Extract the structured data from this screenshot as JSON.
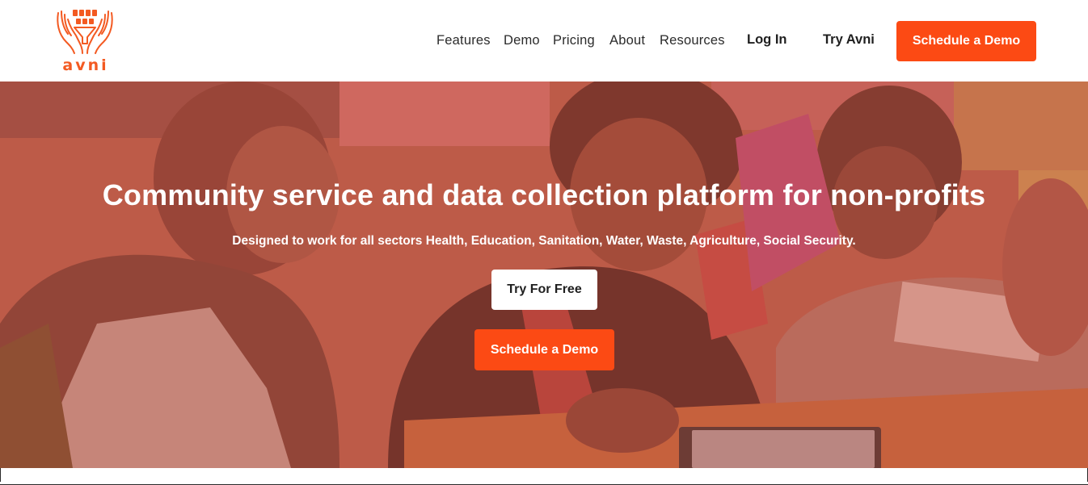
{
  "brand": {
    "name": "avni",
    "accent_color": "#fc4a14",
    "logo_icon": "hands-holding-data-icon"
  },
  "nav": {
    "links": [
      "Features",
      "Demo",
      "Pricing",
      "About",
      "Resources"
    ],
    "login": "Log In",
    "try": "Try Avni",
    "schedule": "Schedule a Demo"
  },
  "hero": {
    "title": "Community service and data collection platform for non-profits",
    "subtitle": "Designed to work for all sectors Health, Education, Sanitation, Water, Waste, Agriculture, Social Security.",
    "try_free": "Try For Free",
    "schedule": "Schedule a Demo",
    "background_image": "women-working-with-tablet-photo"
  }
}
